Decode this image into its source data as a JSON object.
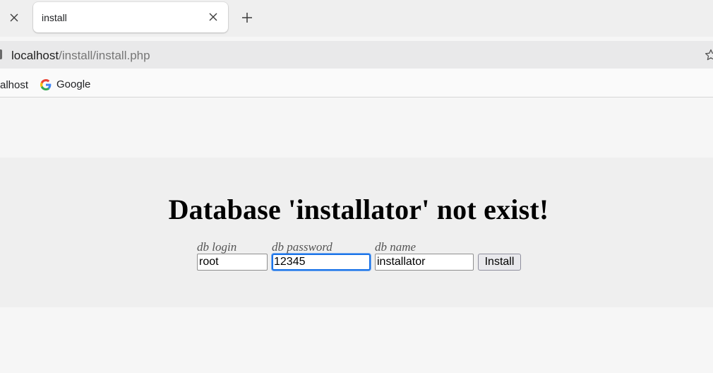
{
  "browser": {
    "tab": {
      "title": "install"
    },
    "address_bar": {
      "host": "localhost",
      "path": "/install/install.php"
    },
    "bookmarks": [
      {
        "label": "alhost"
      },
      {
        "label": "Google",
        "icon": "google-g-icon"
      }
    ],
    "icons": {
      "prev_tab_close": "close-icon",
      "active_tab_close": "close-icon",
      "new_tab": "plus-icon",
      "bookmark_star": "star-icon"
    }
  },
  "page": {
    "heading": "Database 'installator' not exist!",
    "form": {
      "login": {
        "label": "db login",
        "value": "root"
      },
      "password": {
        "label": "db password",
        "value": "12345"
      },
      "name": {
        "label": "db name",
        "value": "installator"
      },
      "submit_label": "Install"
    }
  },
  "colors": {
    "tab_strip": "#efefef",
    "address_bar": "#e9e9ea",
    "focus_ring": "#1a73e8",
    "panel": "#efefef"
  }
}
